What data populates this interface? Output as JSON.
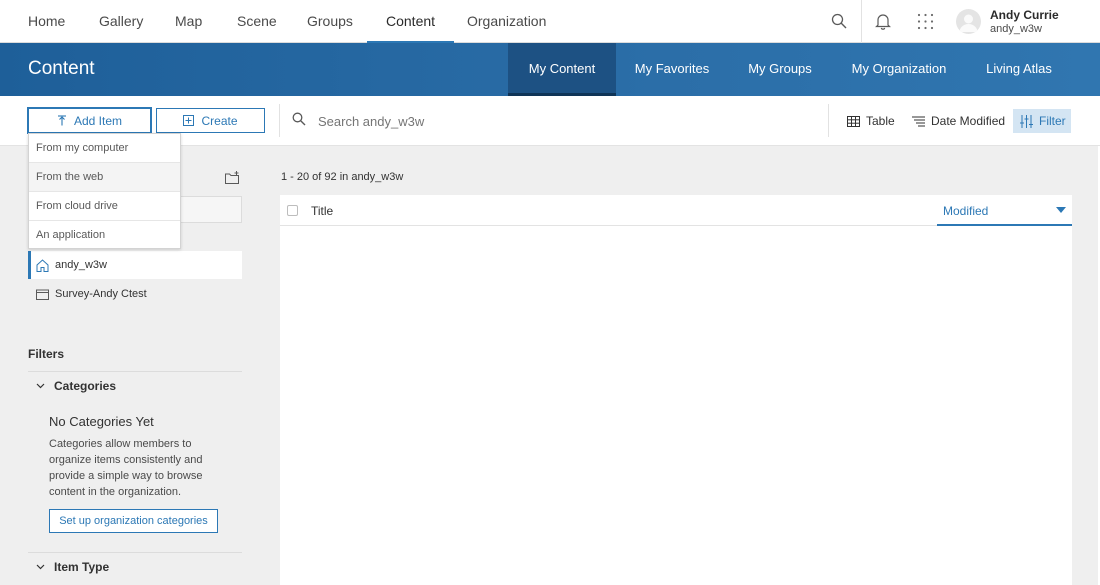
{
  "topnav": {
    "items": [
      {
        "label": "Home"
      },
      {
        "label": "Gallery"
      },
      {
        "label": "Map"
      },
      {
        "label": "Scene"
      },
      {
        "label": "Groups"
      },
      {
        "label": "Content"
      },
      {
        "label": "Organization"
      }
    ],
    "active": "Content",
    "icons": [
      "search-icon",
      "bell-icon",
      "apps-grid-icon"
    ],
    "user": {
      "name": "Andy Currie",
      "username": "andy_w3w"
    }
  },
  "header": {
    "title": "Content",
    "tabs": [
      {
        "label": "My Content"
      },
      {
        "label": "My Favorites"
      },
      {
        "label": "My Groups"
      },
      {
        "label": "My Organization"
      },
      {
        "label": "Living Atlas"
      }
    ],
    "active_tab": "My Content",
    "colors": {
      "accent": "#2c78b5",
      "header_bg": "#2b6ea8",
      "active_tab_bg": "#1d5183"
    }
  },
  "toolbar": {
    "add_item": "Add Item",
    "create": "Create",
    "search_placeholder": "Search andy_w3w",
    "table": "Table",
    "sort": "Date Modified",
    "filter": "Filter"
  },
  "add_menu": {
    "items": [
      "From my computer",
      "From the web",
      "From cloud drive",
      "An application"
    ],
    "hovered": "From the web"
  },
  "sidebar": {
    "folders": [
      {
        "label": "andy_w3w",
        "icon": "home-icon"
      },
      {
        "label": "Survey-Andy Ctest",
        "icon": "folder-icon"
      }
    ],
    "active_folder": "andy_w3w",
    "filters_title": "Filters",
    "categories": {
      "label": "Categories",
      "empty_title": "No Categories Yet",
      "empty_desc": "Categories allow members to organize items consistently and provide a simple way to browse content in the organization.",
      "setup_button": "Set up organization categories"
    },
    "item_type": {
      "label": "Item Type"
    }
  },
  "content": {
    "count_text": "1 - 20 of 92 in andy_w3w",
    "columns": {
      "title": "Title",
      "modified": "Modified"
    }
  }
}
